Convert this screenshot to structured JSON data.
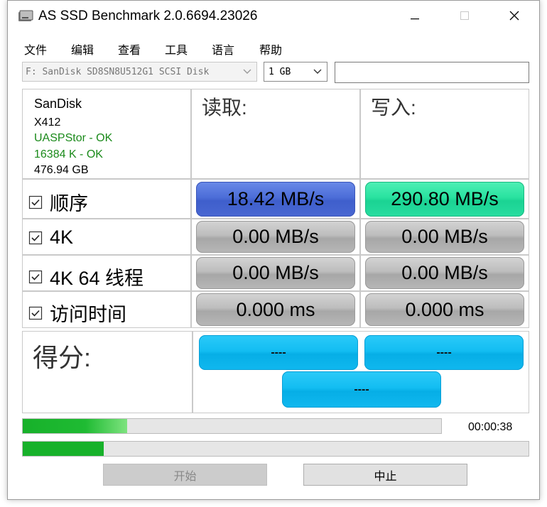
{
  "window": {
    "title": "AS SSD Benchmark 2.0.6694.23026"
  },
  "menu": [
    "文件",
    "编辑",
    "查看",
    "工具",
    "语言",
    "帮助"
  ],
  "drive_select": {
    "value": "F: SanDisk SD8SN8U512G1 SCSI Disk"
  },
  "size_select": {
    "value": "1 GB"
  },
  "right_input": {
    "value": ""
  },
  "device_info": {
    "brand": "SanDisk",
    "model": "X412",
    "driver": "UASPStor - OK",
    "alignment": "16384 K - OK",
    "capacity": "476.94 GB"
  },
  "columns": {
    "read": "读取:",
    "write": "写入:"
  },
  "rows": [
    {
      "label": "顺序",
      "checked": true,
      "read": "18.42 MB/s",
      "write": "290.80 MB/s"
    },
    {
      "label": "4K",
      "checked": true,
      "read": "0.00 MB/s",
      "write": "0.00 MB/s"
    },
    {
      "label": "4K 64 线程",
      "checked": true,
      "read": "0.00 MB/s",
      "write": "0.00 MB/s"
    },
    {
      "label": "访问时间",
      "checked": true,
      "read": "0.000 ms",
      "write": "0.000 ms"
    }
  ],
  "score": {
    "label": "得分:",
    "read": "----",
    "write": "----",
    "total": "----"
  },
  "progress": {
    "overall": 0.25,
    "current": 0.16,
    "elapsed": "00:00:38"
  },
  "buttons": {
    "start": "开始",
    "stop": "中止"
  },
  "colors": {
    "read_active": "#4c6dd8",
    "write_active": "#29e2a0",
    "score": "#13bdf2",
    "progress": "#17b12a",
    "ok_text": "#1a8a1a"
  },
  "icons": {
    "app": "drive-icon",
    "checkbox": "checkbox-checked-icon",
    "dropdown": "chevron-down-icon"
  }
}
